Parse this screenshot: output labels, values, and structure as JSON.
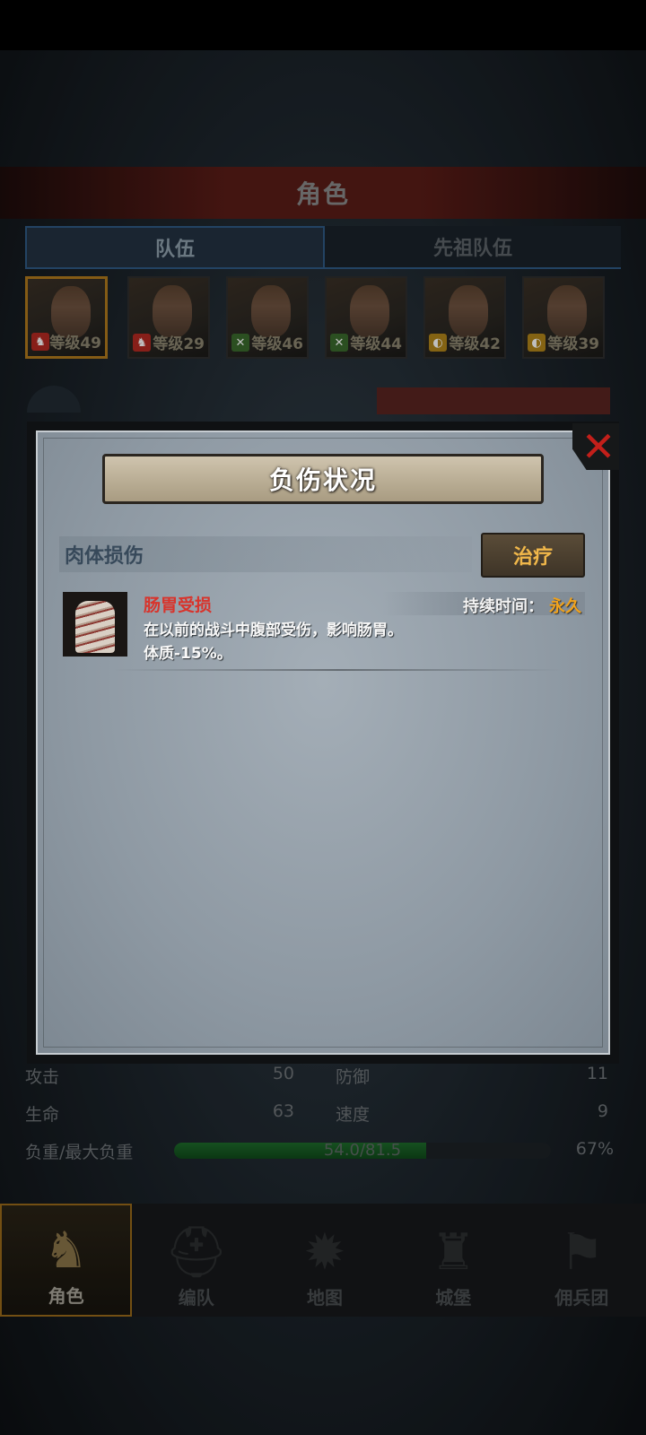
{
  "screen": {
    "title": "角色",
    "tabs": [
      {
        "label": "队伍",
        "active": true
      },
      {
        "label": "先祖队伍",
        "active": false
      }
    ],
    "portraits": [
      {
        "level": "等级49",
        "badge_color": "#b52a22",
        "selected": true
      },
      {
        "level": "等级29",
        "badge_color": "#b52a22",
        "selected": false
      },
      {
        "level": "等级46",
        "badge_color": "#3a6a2c",
        "selected": false
      },
      {
        "level": "等级44",
        "badge_color": "#3a6a2c",
        "selected": false
      },
      {
        "level": "等级42",
        "badge_color": "#b0841a",
        "selected": false
      },
      {
        "level": "等级39",
        "badge_color": "#b0841a",
        "selected": false
      }
    ],
    "stats": {
      "attack_label": "攻击",
      "attack_value": "50",
      "defense_label": "防御",
      "defense_value": "11",
      "life_label": "生命",
      "life_value": "63",
      "speed_label": "速度",
      "speed_value": "9",
      "load_label": "负重/最大负重",
      "load_value": "54.0/81.5",
      "load_percent": "67%",
      "load_fraction": 0.67
    },
    "nav": [
      {
        "label": "角色",
        "icon": "knight-icon",
        "active": true
      },
      {
        "label": "编队",
        "icon": "helmet-icon",
        "active": false
      },
      {
        "label": "地图",
        "icon": "compass-icon",
        "active": false
      },
      {
        "label": "城堡",
        "icon": "castle-icon",
        "active": false
      },
      {
        "label": "佣兵团",
        "icon": "flag-icon",
        "active": false
      }
    ]
  },
  "dialog": {
    "title": "负伤状况",
    "section_title": "肉体损伤",
    "heal_button": "治疗",
    "injury": {
      "name": "肠胃受损",
      "duration_label": "持续时间：",
      "duration_value": "永久",
      "description_line1": "在以前的战斗中腹部受伤，影响肠胃。",
      "description_line2": "体质-15%。"
    },
    "close_icon": "close-icon"
  },
  "colors": {
    "accent_gold": "#f0a21c",
    "injury_red": "#d8342c",
    "close_red": "#c21f1a"
  }
}
